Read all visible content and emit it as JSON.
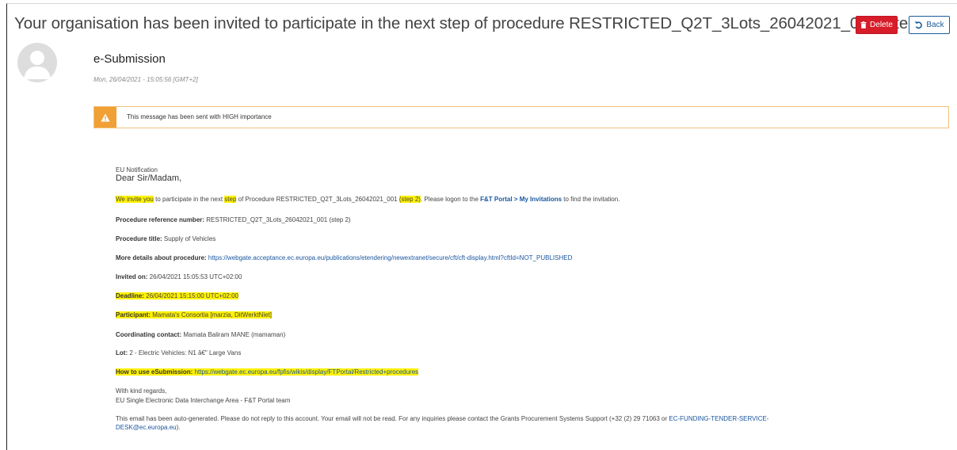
{
  "header": {
    "title": "Your organisation has been invited to participate in the next step of procedure RESTRICTED_Q2T_3Lots_26042021_001 (step 2)",
    "delete_label": "Delete",
    "back_label": "Back"
  },
  "message": {
    "sender": "e-Submission",
    "date": "Mon, 26/04/2021 - 15:05:56 [GMT+2]",
    "alert": "This message has been sent with HIGH importance"
  },
  "body": {
    "notification": "EU Notification",
    "greeting": "Dear Sir/Madam,",
    "invite": {
      "t1": "We invite you",
      "t2": " to participate in the next ",
      "t3": "step",
      "t4": " of Procedure RESTRICTED_Q2T_3Lots_26042021_001 ",
      "t5": "(step 2)",
      "t6": ". Please logon to the ",
      "link": "F&T Portal > My Invitations",
      "t7": " to find the invitation."
    },
    "ref_label": "Procedure reference number:",
    "ref_value": " RESTRICTED_Q2T_3Lots_26042021_001 (step 2)",
    "title_label": "Procedure title:",
    "title_value": " Supply of Vehicles",
    "details_label": "More details about procedure:",
    "details_link": "https://webgate.acceptance.ec.europa.eu/publications/etendering/newextranet/secure/cft/cft-display.html?cftId=NOT_PUBLISHED",
    "invited_label": "Invited on:",
    "invited_value": " 26/04/2021 15:05:53 UTC+02:00",
    "deadline_label": "Deadline:",
    "deadline_value": " 26/04/2021 15:15:00 UTC+02:00",
    "participant_label": "Participant:",
    "participant_value": " Mamata's Consortia [marzia, DitWerktNiet]",
    "coord_label": "Coordinating contact:",
    "coord_value": " Mamata Baliram MANE (mamaman)",
    "lot_label": "Lot:",
    "lot_value": " 2 - Electric Vehicles: N1 â€\" Large Vans",
    "howto_label": "How to use eSubmission:",
    "howto_link": " https://webgate.ec.europa.eu/fpfis/wikis/display/FTPortal/Restricted+procedures",
    "regards": "With kind regards,",
    "team": "EU Single Electronic Data Interchange Area - F&T Portal team",
    "footer_1": "This email has been auto-generated. Please do not reply to this account. Your email will not be read. For any inquiries please contact the Grants Procurement Systems Support (+32 (2) 29 71063 or ",
    "footer_link_1": "EC-FUNDING-TENDER-SERVICE-",
    "footer_link_2": "DESK@ec.europa.eu",
    "footer_2": ")."
  },
  "colors": {
    "delete": "#d71d2a",
    "back": "#1a5c9c",
    "alert": "#f0a035",
    "highlight": "#fff200",
    "link": "#1a56a0"
  },
  "icons": {
    "delete": "trash-icon",
    "back": "undo-icon",
    "alert": "warning-icon",
    "avatar": "user-avatar-icon"
  }
}
